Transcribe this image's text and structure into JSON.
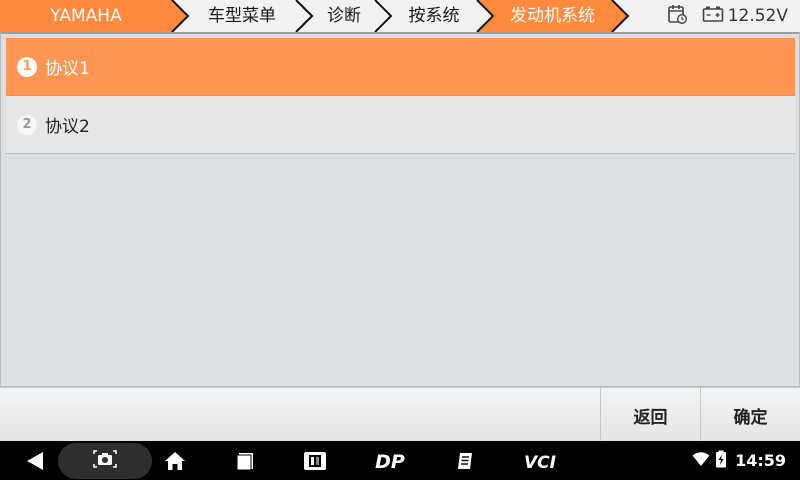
{
  "breadcrumb": {
    "items": [
      {
        "label": "YAMAHA",
        "active": true
      },
      {
        "label": "车型菜单",
        "active": false
      },
      {
        "label": "诊断",
        "active": false
      },
      {
        "label": "按系统",
        "active": false
      },
      {
        "label": "发动机系统",
        "active": true
      }
    ]
  },
  "status": {
    "voltage": "12.52V",
    "calendar_icon": "calendar-clock-icon",
    "battery_icon": "car-battery-icon"
  },
  "list": {
    "items": [
      {
        "number": "1",
        "label": "协议1",
        "selected": true
      },
      {
        "number": "2",
        "label": "协议2",
        "selected": false
      }
    ]
  },
  "buttons": {
    "back_label": "返回",
    "ok_label": "确定"
  },
  "navbar": {
    "icons": [
      "back-triangle-icon",
      "screenshot-camera-icon",
      "home-icon",
      "recents-square-icon",
      "vehicle-app-icon",
      "dp-logo-icon",
      "manual-book-icon",
      "vci-icon"
    ],
    "vci_text": "VCI",
    "dp_text": "DP",
    "time": "14:59"
  },
  "colors": {
    "accent": "#ff9555",
    "active_crumb": "#ff8a3d",
    "inactive_crumb": "#f2f2f2",
    "content_bg": "#dcdfe1"
  }
}
